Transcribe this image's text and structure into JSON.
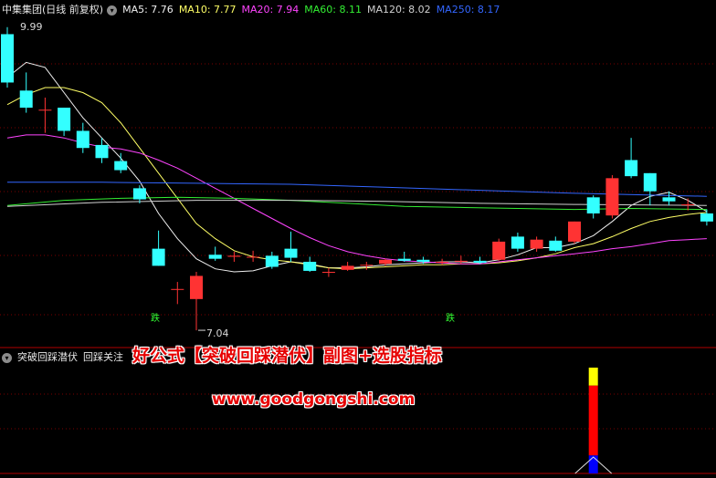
{
  "main_header": {
    "title": "中集集团(日线 前复权)",
    "ma_items": [
      {
        "label": "MA5: 7.76",
        "color": "#f0f0f0"
      },
      {
        "label": "MA10: 7.77",
        "color": "#ffff66"
      },
      {
        "label": "MA20: 7.94",
        "color": "#ff44ff"
      },
      {
        "label": "MA60: 8.11",
        "color": "#33ee33"
      },
      {
        "label": "MA120: 8.02",
        "color": "#d0d0d0"
      },
      {
        "label": "MA250: 8.17",
        "color": "#3366ff"
      }
    ]
  },
  "sub_header": {
    "indicator_name": "突破回踩潜伏",
    "signal_label": "回踩关注"
  },
  "price_labels": {
    "high": "9.99",
    "low": "7.04"
  },
  "chart_markers": {
    "sell_mark_1": "跌",
    "sell_mark_2": "跌"
  },
  "overlay": {
    "title": "好公式【突破回踩潜伏】副图+选股指标",
    "url": "www.goodgongshi.com"
  },
  "chart_data": {
    "type": "candlestick",
    "ylim": [
      6.95,
      10.12
    ],
    "colors": {
      "up": "#ff3333",
      "down": "#33ffff",
      "grid": "#7a0000"
    },
    "candles": [
      {
        "o": 9.98,
        "c": 9.5,
        "h": 10.05,
        "l": 9.45
      },
      {
        "o": 9.42,
        "c": 9.25,
        "h": 9.6,
        "l": 9.2
      },
      {
        "o": 9.23,
        "c": 9.23,
        "h": 9.35,
        "l": 9.0
      },
      {
        "o": 9.25,
        "c": 9.02,
        "h": 9.25,
        "l": 8.97
      },
      {
        "o": 9.02,
        "c": 8.85,
        "h": 9.1,
        "l": 8.8
      },
      {
        "o": 8.88,
        "c": 8.75,
        "h": 8.95,
        "l": 8.7
      },
      {
        "o": 8.72,
        "c": 8.63,
        "h": 8.8,
        "l": 8.6
      },
      {
        "o": 8.45,
        "c": 8.34,
        "h": 8.48,
        "l": 8.3
      },
      {
        "o": 7.85,
        "c": 7.68,
        "h": 8.03,
        "l": 7.68
      },
      {
        "o": 7.45,
        "c": 7.45,
        "h": 7.52,
        "l": 7.3
      },
      {
        "o": 7.35,
        "c": 7.58,
        "h": 7.62,
        "l": 7.04
      },
      {
        "o": 7.79,
        "c": 7.75,
        "h": 7.87,
        "l": 7.73
      },
      {
        "o": 7.77,
        "c": 7.78,
        "h": 7.82,
        "l": 7.72
      },
      {
        "o": 7.77,
        "c": 7.77,
        "h": 7.83,
        "l": 7.72
      },
      {
        "o": 7.78,
        "c": 7.67,
        "h": 7.82,
        "l": 7.65
      },
      {
        "o": 7.85,
        "c": 7.76,
        "h": 8.02,
        "l": 7.72
      },
      {
        "o": 7.72,
        "c": 7.63,
        "h": 7.77,
        "l": 7.62
      },
      {
        "o": 7.62,
        "c": 7.62,
        "h": 7.66,
        "l": 7.57
      },
      {
        "o": 7.64,
        "c": 7.68,
        "h": 7.72,
        "l": 7.63
      },
      {
        "o": 7.69,
        "c": 7.69,
        "h": 7.72,
        "l": 7.64
      },
      {
        "o": 7.7,
        "c": 7.74,
        "h": 7.75,
        "l": 7.68
      },
      {
        "o": 7.75,
        "c": 7.73,
        "h": 7.82,
        "l": 7.72
      },
      {
        "o": 7.74,
        "c": 7.72,
        "h": 7.77,
        "l": 7.7
      },
      {
        "o": 7.72,
        "c": 7.72,
        "h": 7.75,
        "l": 7.69
      },
      {
        "o": 7.73,
        "c": 7.73,
        "h": 7.78,
        "l": 7.7
      },
      {
        "o": 7.73,
        "c": 7.71,
        "h": 7.77,
        "l": 7.7
      },
      {
        "o": 7.74,
        "c": 7.92,
        "h": 7.95,
        "l": 7.73
      },
      {
        "o": 7.97,
        "c": 7.85,
        "h": 8.01,
        "l": 7.82
      },
      {
        "o": 7.85,
        "c": 7.94,
        "h": 7.97,
        "l": 7.82
      },
      {
        "o": 7.93,
        "c": 7.83,
        "h": 7.97,
        "l": 7.82
      },
      {
        "o": 7.92,
        "c": 8.12,
        "h": 8.12,
        "l": 7.9
      },
      {
        "o": 8.36,
        "c": 8.2,
        "h": 8.38,
        "l": 8.15
      },
      {
        "o": 8.18,
        "c": 8.55,
        "h": 8.58,
        "l": 8.15
      },
      {
        "o": 8.73,
        "c": 8.57,
        "h": 8.95,
        "l": 8.55
      },
      {
        "o": 8.6,
        "c": 8.42,
        "h": 8.6,
        "l": 8.28
      },
      {
        "o": 8.36,
        "c": 8.32,
        "h": 8.42,
        "l": 8.28
      },
      {
        "o": 8.29,
        "c": 8.29,
        "h": 8.35,
        "l": 8.23
      },
      {
        "o": 8.2,
        "c": 8.12,
        "h": 8.24,
        "l": 8.08
      }
    ],
    "ma_lines": [
      {
        "name": "MA5",
        "color": "#f0f0f0",
        "points": [
          [
            0,
            9.55
          ],
          [
            1,
            9.7
          ],
          [
            2,
            9.65
          ],
          [
            3,
            9.4
          ],
          [
            4,
            9.15
          ],
          [
            5,
            8.95
          ],
          [
            6,
            8.75
          ],
          [
            7,
            8.52
          ],
          [
            8,
            8.2
          ],
          [
            9,
            7.95
          ],
          [
            10,
            7.75
          ],
          [
            11,
            7.65
          ],
          [
            12,
            7.62
          ],
          [
            13,
            7.63
          ],
          [
            14,
            7.68
          ],
          [
            15,
            7.72
          ],
          [
            16,
            7.7
          ],
          [
            17,
            7.66
          ],
          [
            18,
            7.66
          ],
          [
            19,
            7.67
          ],
          [
            20,
            7.69
          ],
          [
            21,
            7.7
          ],
          [
            22,
            7.71
          ],
          [
            23,
            7.72
          ],
          [
            24,
            7.72
          ],
          [
            25,
            7.71
          ],
          [
            26,
            7.74
          ],
          [
            27,
            7.79
          ],
          [
            28,
            7.86
          ],
          [
            29,
            7.86
          ],
          [
            30,
            7.9
          ],
          [
            31,
            7.98
          ],
          [
            32,
            8.12
          ],
          [
            33,
            8.28
          ],
          [
            34,
            8.37
          ],
          [
            35,
            8.41
          ],
          [
            36,
            8.33
          ],
          [
            37,
            8.22
          ]
        ]
      },
      {
        "name": "MA10",
        "color": "#ffff66",
        "points": [
          [
            0,
            9.28
          ],
          [
            1,
            9.38
          ],
          [
            2,
            9.45
          ],
          [
            3,
            9.45
          ],
          [
            4,
            9.4
          ],
          [
            5,
            9.3
          ],
          [
            6,
            9.1
          ],
          [
            7,
            8.85
          ],
          [
            8,
            8.6
          ],
          [
            9,
            8.35
          ],
          [
            10,
            8.1
          ],
          [
            11,
            7.95
          ],
          [
            12,
            7.83
          ],
          [
            13,
            7.77
          ],
          [
            14,
            7.74
          ],
          [
            15,
            7.72
          ],
          [
            16,
            7.69
          ],
          [
            17,
            7.66
          ],
          [
            18,
            7.65
          ],
          [
            19,
            7.66
          ],
          [
            20,
            7.67
          ],
          [
            21,
            7.68
          ],
          [
            22,
            7.69
          ],
          [
            23,
            7.69
          ],
          [
            24,
            7.7
          ],
          [
            25,
            7.7
          ],
          [
            26,
            7.71
          ],
          [
            27,
            7.73
          ],
          [
            28,
            7.76
          ],
          [
            29,
            7.8
          ],
          [
            30,
            7.86
          ],
          [
            31,
            7.9
          ],
          [
            32,
            7.97
          ],
          [
            33,
            8.05
          ],
          [
            34,
            8.12
          ],
          [
            35,
            8.16
          ],
          [
            36,
            8.19
          ],
          [
            37,
            8.21
          ]
        ]
      },
      {
        "name": "MA20",
        "color": "#ff44ff",
        "points": [
          [
            0,
            8.95
          ],
          [
            1,
            8.98
          ],
          [
            2,
            8.98
          ],
          [
            3,
            8.95
          ],
          [
            4,
            8.9
          ],
          [
            5,
            8.86
          ],
          [
            6,
            8.84
          ],
          [
            7,
            8.8
          ],
          [
            8,
            8.73
          ],
          [
            9,
            8.65
          ],
          [
            10,
            8.55
          ],
          [
            11,
            8.45
          ],
          [
            12,
            8.35
          ],
          [
            13,
            8.25
          ],
          [
            14,
            8.15
          ],
          [
            15,
            8.05
          ],
          [
            16,
            7.96
          ],
          [
            17,
            7.88
          ],
          [
            18,
            7.82
          ],
          [
            19,
            7.78
          ],
          [
            20,
            7.75
          ],
          [
            21,
            7.73
          ],
          [
            22,
            7.72
          ],
          [
            23,
            7.71
          ],
          [
            24,
            7.7
          ],
          [
            25,
            7.7
          ],
          [
            26,
            7.72
          ],
          [
            27,
            7.74
          ],
          [
            28,
            7.76
          ],
          [
            29,
            7.78
          ],
          [
            30,
            7.8
          ],
          [
            31,
            7.82
          ],
          [
            32,
            7.85
          ],
          [
            33,
            7.87
          ],
          [
            34,
            7.9
          ],
          [
            35,
            7.93
          ],
          [
            36,
            7.94
          ],
          [
            37,
            7.95
          ]
        ]
      },
      {
        "name": "MA60",
        "color": "#33ee33",
        "points": [
          [
            0,
            8.28
          ],
          [
            3,
            8.33
          ],
          [
            6,
            8.35
          ],
          [
            9,
            8.36
          ],
          [
            12,
            8.35
          ],
          [
            15,
            8.33
          ],
          [
            18,
            8.3
          ],
          [
            21,
            8.27
          ],
          [
            24,
            8.26
          ],
          [
            27,
            8.25
          ],
          [
            30,
            8.24
          ],
          [
            33,
            8.25
          ],
          [
            37,
            8.24
          ]
        ]
      },
      {
        "name": "MA120",
        "color": "#d0d0d0",
        "points": [
          [
            0,
            8.27
          ],
          [
            5,
            8.31
          ],
          [
            10,
            8.33
          ],
          [
            15,
            8.33
          ],
          [
            20,
            8.32
          ],
          [
            25,
            8.3
          ],
          [
            30,
            8.29
          ],
          [
            37,
            8.28
          ]
        ]
      },
      {
        "name": "MA250",
        "color": "#3366ff",
        "points": [
          [
            0,
            8.51
          ],
          [
            5,
            8.51
          ],
          [
            10,
            8.5
          ],
          [
            15,
            8.49
          ],
          [
            20,
            8.46
          ],
          [
            25,
            8.43
          ],
          [
            30,
            8.4
          ],
          [
            37,
            8.37
          ]
        ]
      }
    ],
    "indicator": {
      "signal_index": 31,
      "stack_fraction": {
        "yellow": 0.17,
        "red": 0.66,
        "blue": 0.17
      }
    }
  }
}
